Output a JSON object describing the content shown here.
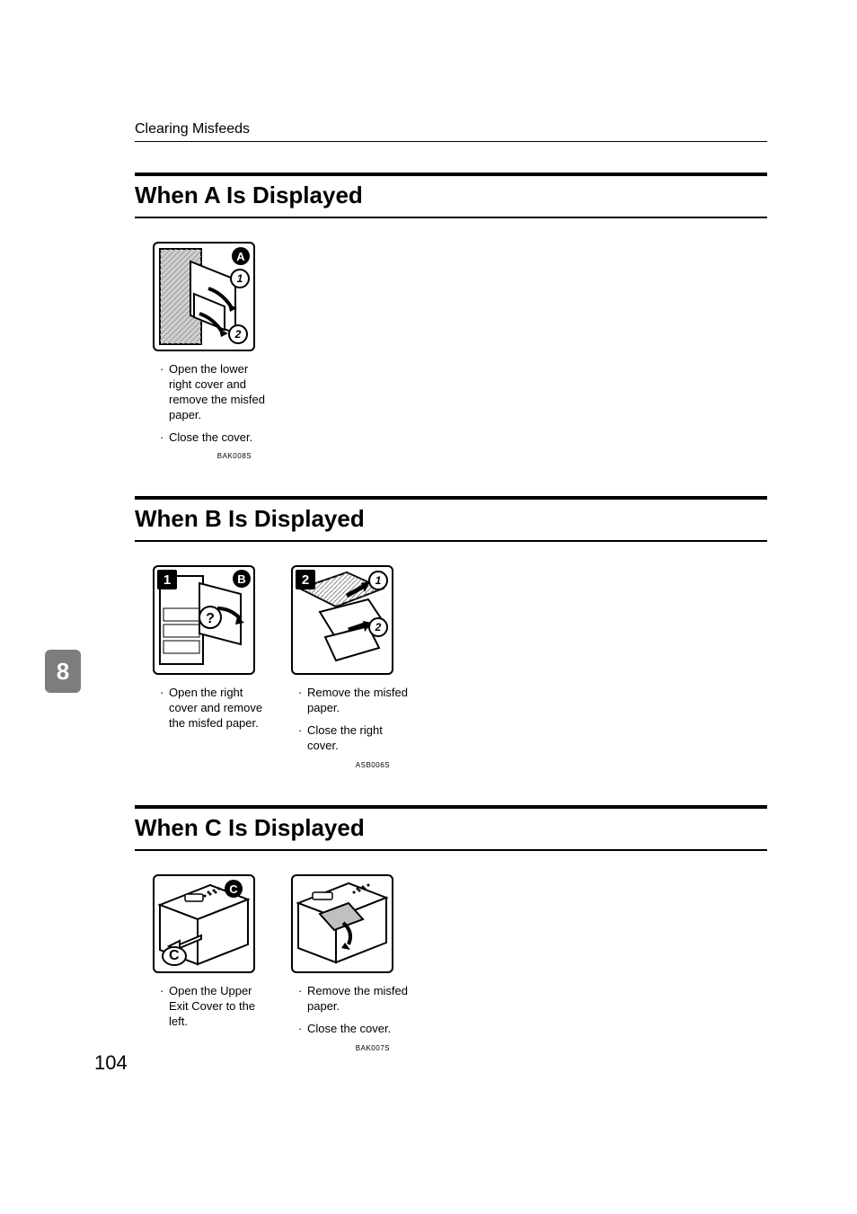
{
  "running_head": "Clearing Misfeeds",
  "chapter_number": "8",
  "page_number": "104",
  "section_a": {
    "heading": "When A Is Displayed",
    "badge_letter": "A",
    "step1_num": "1",
    "step2_num": "2",
    "captions": [
      "Open the lower right cover and remove the misfed paper.",
      "Close the cover."
    ],
    "figcode": "BAK008S"
  },
  "section_b": {
    "heading": "When B Is Displayed",
    "panel1": {
      "square": "1",
      "letter": "B",
      "captions": [
        "Open the right cover and remove the misfed paper."
      ]
    },
    "panel2": {
      "square": "2",
      "step1_num": "1",
      "step2_num": "2",
      "captions": [
        "Remove the misfed paper.",
        "Close the right cover."
      ]
    },
    "figcode": "ASB006S"
  },
  "section_c": {
    "heading": "When C Is Displayed",
    "panel1": {
      "letter_circle": "C",
      "letter_box": "C",
      "captions": [
        "Open the Upper Exit Cover to the left."
      ]
    },
    "panel2": {
      "captions": [
        "Remove the misfed paper.",
        "Close the cover."
      ]
    },
    "figcode": "BAK007S"
  }
}
